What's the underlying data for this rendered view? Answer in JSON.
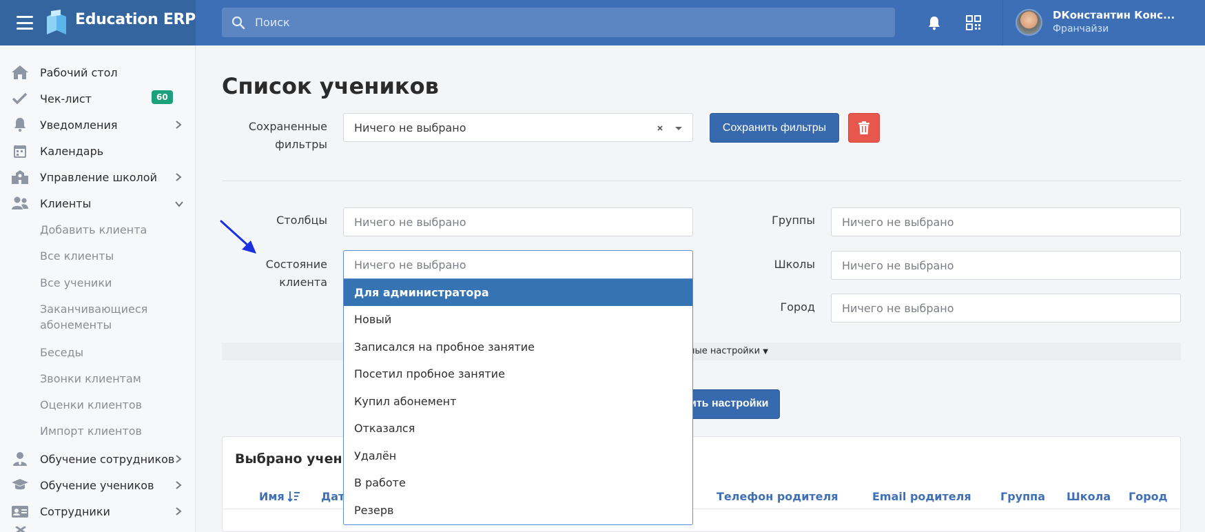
{
  "app": {
    "name": "Education ERP"
  },
  "search": {
    "placeholder": "Поиск"
  },
  "user": {
    "name": "DКонстантин Конс...",
    "role": "Франчайзи"
  },
  "sidebar": {
    "items": [
      {
        "label": "Рабочий стол",
        "icon": "home-icon"
      },
      {
        "label": "Чек-лист",
        "icon": "check-icon",
        "badge": "60"
      },
      {
        "label": "Уведомления",
        "icon": "bell-icon"
      },
      {
        "label": "Календарь",
        "icon": "calendar-icon"
      },
      {
        "label": "Управление школой",
        "icon": "school-icon"
      },
      {
        "label": "Клиенты",
        "icon": "users-icon"
      },
      {
        "label": "Обучение сотрудников",
        "icon": "user-tie-icon"
      },
      {
        "label": "Обучение учеников",
        "icon": "graduation-cap-icon"
      },
      {
        "label": "Сотрудники",
        "icon": "id-card-icon"
      }
    ],
    "clients_sub": [
      "Добавить клиента",
      "Все клиенты",
      "Все ученики",
      "Заканчивающиеся абонементы",
      "Беседы",
      "Звонки клиентам",
      "Оценки клиентов",
      "Импорт клиентов"
    ]
  },
  "page": {
    "title": "Список учеников"
  },
  "filters": {
    "saved_label_1": "Сохраненные",
    "saved_label_2": "фильтры",
    "saved_value": "Ничего не выбрано",
    "save_button": "Сохранить фильтры",
    "columns_label": "Столбцы",
    "columns_value": "Ничего не выбрано",
    "state_label": "Состояние клиента",
    "state_value": "Ничего не выбрано",
    "groups_label": "Группы",
    "groups_value": "Ничего не выбрано",
    "schools_label": "Школы",
    "schools_value": "Ничего не выбрано",
    "city_label": "Город",
    "city_value": "Ничего не выбрано",
    "extra_settings": "ные настройки",
    "apply_button": "ить настройки"
  },
  "dropdown": {
    "options": [
      "Для администратора",
      "Новый",
      "Записался на пробное занятие",
      "Посетил пробное занятие",
      "Купил абонемент",
      "Отказался",
      "Удалён",
      "В работе",
      "Резерв"
    ],
    "active_index": 0
  },
  "table": {
    "title": "Выбрано ученико",
    "columns": [
      "Имя",
      "Дата",
      "Телефон родителя",
      "Email родителя",
      "Группа",
      "Школа",
      "Город"
    ]
  },
  "colors": {
    "header": "#3d6fb6",
    "brand_bg": "#35659f",
    "primary": "#3669ad",
    "danger": "#e8574b",
    "badge": "#1aa07a",
    "arrow": "#1a2fe0"
  }
}
